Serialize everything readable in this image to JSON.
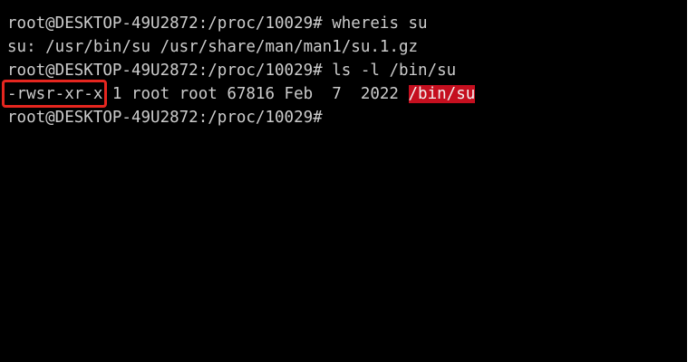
{
  "terminal": {
    "lines": [
      {
        "prompt": "root@DESKTOP-49U2872:/proc/10029#",
        "command": " whereis su"
      },
      {
        "output": "su: /usr/bin/su /usr/share/man/man1/su.1.gz"
      },
      {
        "prompt": "root@DESKTOP-49U2872:/proc/10029#",
        "command": " ls -l /bin/su"
      },
      {
        "permissions": "-rwsr-xr-x",
        "details": " 1 root root 67816 Feb  7  2022 ",
        "filename": "/bin/su"
      },
      {
        "prompt": "root@DESKTOP-49U2872:/proc/10029#"
      }
    ]
  },
  "colors": {
    "background": "#000000",
    "foreground": "#cccccc",
    "annotation_box": "#e5261f",
    "setuid_highlight_bg": "#c50f1f"
  }
}
